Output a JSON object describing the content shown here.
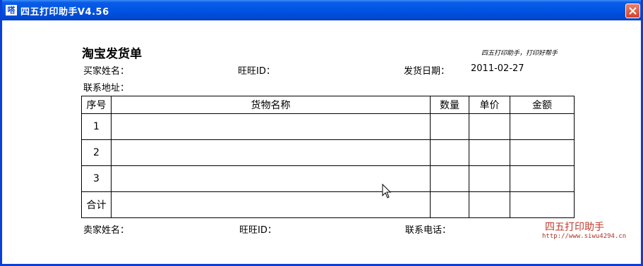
{
  "window": {
    "title": "四五打印助手V4.56",
    "icon_label": "嗒"
  },
  "document": {
    "title": "淘宝发货单",
    "slogan": "四五打印助手，打印好帮手",
    "buyer_name_label": "买家姓名：",
    "buyer_wangwang_label": "旺旺ID：",
    "ship_date_label": "发货日期：",
    "ship_date_value": "2011-02-27",
    "address_label": "联系地址：",
    "table": {
      "headers": [
        "序号",
        "货物名称",
        "数量",
        "单价",
        "金额"
      ],
      "rows": [
        [
          "1",
          "",
          "",
          "",
          ""
        ],
        [
          "2",
          "",
          "",
          "",
          ""
        ],
        [
          "3",
          "",
          "",
          "",
          ""
        ],
        [
          "合计",
          "",
          "",
          "",
          ""
        ]
      ]
    },
    "seller_name_label": "卖家姓名：",
    "seller_wangwang_label": "旺旺ID：",
    "phone_label": "联系电话："
  },
  "footer": {
    "brand": "四五打印助手",
    "url": "http://www.siwu4294.cn"
  },
  "colors": {
    "titlebar": "#0054e3",
    "close_button": "#d4432a",
    "brand": "#c0392b"
  },
  "icons": [
    "app-icon",
    "close-icon",
    "mouse-cursor-icon"
  ]
}
